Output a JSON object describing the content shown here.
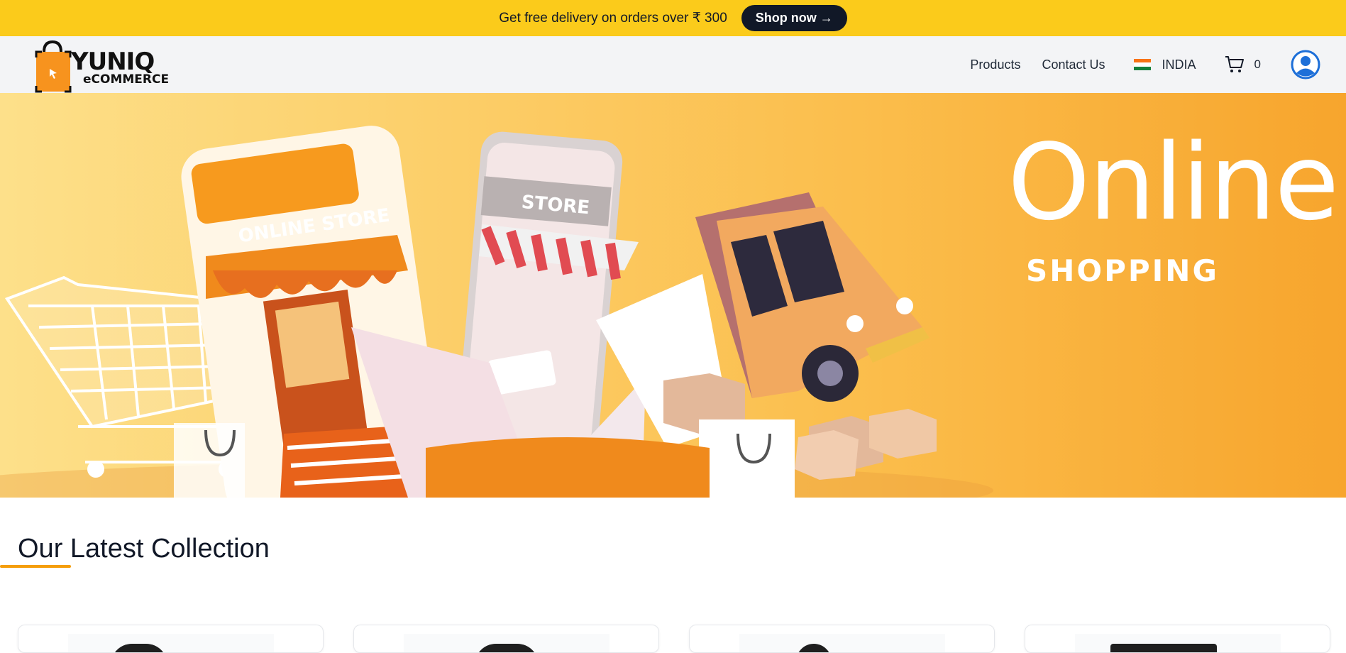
{
  "promo": {
    "text": "Get free delivery on orders over ₹ 300",
    "button": "Shop now →"
  },
  "header": {
    "logo_main": "YUNIQ",
    "logo_sub": "eCOMMERCE",
    "nav": {
      "products": "Products",
      "contact": "Contact Us",
      "country": "INDIA",
      "cart_count": "0"
    }
  },
  "hero": {
    "title": "Online.",
    "subtitle": "SHOPPING",
    "store_sign": "ONLINE STORE",
    "phone_sign": "STORE"
  },
  "collection": {
    "title": "Our Latest Collection",
    "cards": [
      {
        "name": "product-card-1"
      },
      {
        "name": "product-card-2"
      },
      {
        "name": "product-card-3"
      },
      {
        "name": "product-card-4"
      }
    ]
  },
  "colors": {
    "promo_bg": "#fbcb1b",
    "accent": "#f59e0b",
    "account_blue": "#1d6fd8"
  },
  "icons": [
    "cart-icon",
    "user-account-icon",
    "india-flag-icon",
    "shopping-bag-logo-icon"
  ]
}
